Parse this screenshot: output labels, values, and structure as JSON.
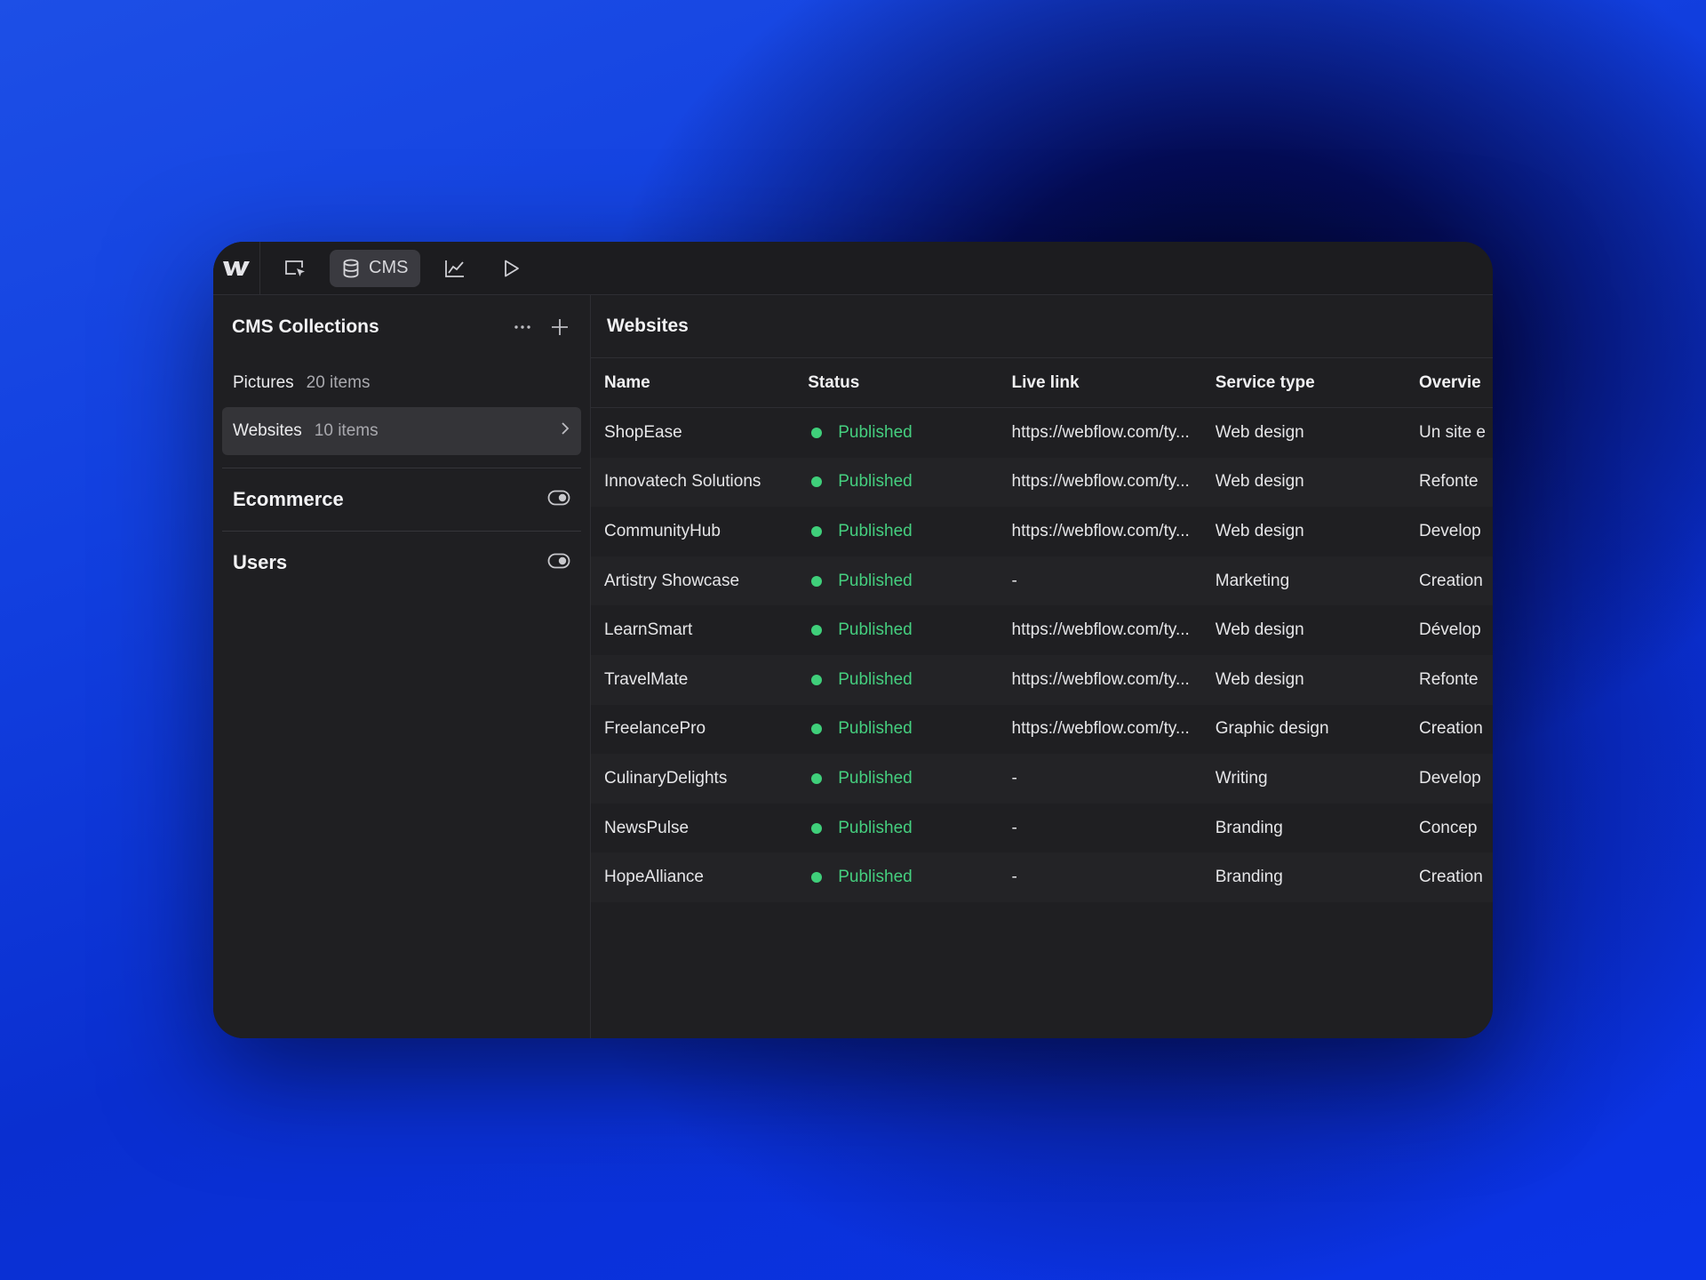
{
  "topbar": {
    "logo": "webflow-logo",
    "tabs": [
      {
        "icon": "cursor-select-icon",
        "label": ""
      },
      {
        "icon": "database-icon",
        "label": "CMS"
      },
      {
        "icon": "chart-icon",
        "label": ""
      },
      {
        "icon": "play-icon",
        "label": ""
      }
    ]
  },
  "sidebar": {
    "title": "CMS Collections",
    "collections": [
      {
        "name": "Pictures",
        "count": "20 items"
      },
      {
        "name": "Websites",
        "count": "10 items"
      }
    ],
    "sections": [
      {
        "title": "Ecommerce"
      },
      {
        "title": "Users"
      }
    ]
  },
  "main": {
    "title": "Websites",
    "columns": [
      "Name",
      "Status",
      "Live link",
      "Service type",
      "Overvie"
    ],
    "rows": [
      {
        "name": "ShopEase",
        "status": "Published",
        "link": "https://webflow.com/ty...",
        "service": "Web design",
        "overview": "Un site e"
      },
      {
        "name": "Innovatech Solutions",
        "status": "Published",
        "link": "https://webflow.com/ty...",
        "service": "Web design",
        "overview": "Refonte"
      },
      {
        "name": "CommunityHub",
        "status": "Published",
        "link": "https://webflow.com/ty...",
        "service": "Web design",
        "overview": "Develop"
      },
      {
        "name": "Artistry Showcase",
        "status": "Published",
        "link": "-",
        "service": "Marketing",
        "overview": "Creation"
      },
      {
        "name": "LearnSmart",
        "status": "Published",
        "link": "https://webflow.com/ty...",
        "service": "Web design",
        "overview": "Dévelop"
      },
      {
        "name": "TravelMate",
        "status": "Published",
        "link": "https://webflow.com/ty...",
        "service": "Web design",
        "overview": "Refonte"
      },
      {
        "name": "FreelancePro",
        "status": "Published",
        "link": "https://webflow.com/ty...",
        "service": "Graphic design",
        "overview": "Creation"
      },
      {
        "name": "CulinaryDelights",
        "status": "Published",
        "link": "-",
        "service": "Writing",
        "overview": "Develop"
      },
      {
        "name": "NewsPulse",
        "status": "Published",
        "link": "-",
        "service": "Branding",
        "overview": "Concep"
      },
      {
        "name": "HopeAlliance",
        "status": "Published",
        "link": "-",
        "service": "Branding",
        "overview": "Creation"
      }
    ]
  },
  "colors": {
    "status_published": "#45cf7f",
    "panel_bg": "#1f1f22",
    "selected_bg": "#343438"
  }
}
